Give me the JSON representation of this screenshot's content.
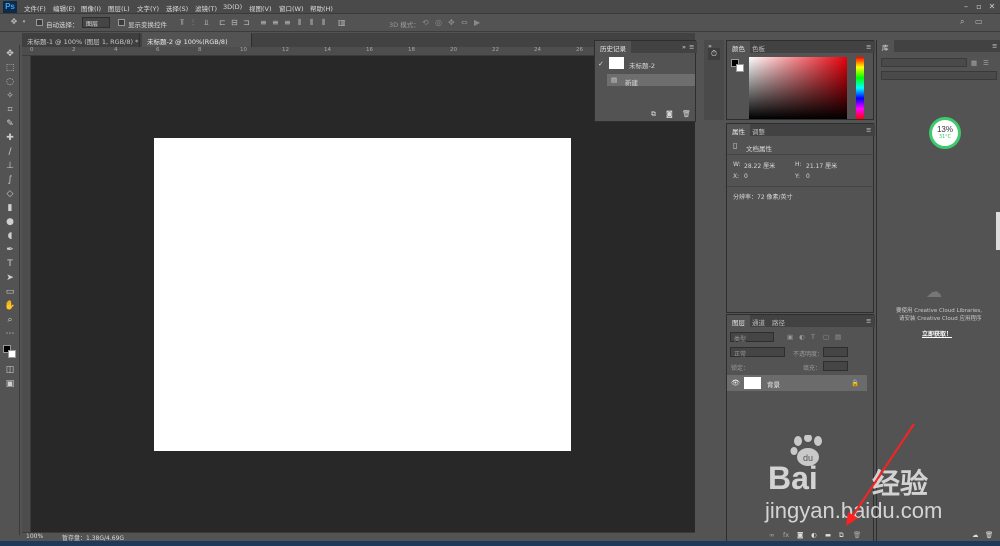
{
  "app": {
    "logo": "Ps"
  },
  "menu": [
    "文件(F)",
    "编辑(E)",
    "图像(I)",
    "图层(L)",
    "文字(Y)",
    "选择(S)",
    "滤镜(T)",
    "3D(D)",
    "视图(V)",
    "窗口(W)",
    "帮助(H)"
  ],
  "options": {
    "auto_select": "自动选择：",
    "auto_select_value": "图层",
    "show_transform": "显示变换控件",
    "mode_3d": "3D 模式："
  },
  "tabs": [
    {
      "label": "未标题-1 @ 100% (图层 1, RGB/8) *",
      "active": false
    },
    {
      "label": "未标题-2 @ 100%(RGB/8)",
      "active": true
    }
  ],
  "ruler": [
    "0",
    "2",
    "4",
    "6",
    "8",
    "10",
    "12",
    "14",
    "16",
    "18",
    "20",
    "22",
    "24",
    "26",
    "28",
    "30"
  ],
  "status": {
    "zoom": "100%",
    "scratch": "暂存盘：1.38G/4.69G"
  },
  "history": {
    "tab": "历史记录",
    "snapshot": "未标题-2",
    "step": "新建"
  },
  "color": {
    "tab1": "颜色",
    "tab2": "色板",
    "foreground": "#000000",
    "background": "#ffffff"
  },
  "properties": {
    "tab1": "属性",
    "tab2": "调整",
    "type": "文档属性",
    "w_label": "W:",
    "w_value": "28.22 厘米",
    "h_label": "H:",
    "h_value": "21.17 厘米",
    "x_label": "X:",
    "x_value": "0",
    "y_label": "Y:",
    "y_value": "0",
    "resolution": "分辨率：72 像素/英寸"
  },
  "layers": {
    "tab1": "图层",
    "tab2": "通道",
    "tab3": "路径",
    "filter": "类型",
    "blend": "正常",
    "opacity_label": "不透明度：",
    "lock_label": "锁定：",
    "fill_label": "填充：",
    "layer_name": "背景"
  },
  "library": {
    "tab": "库",
    "badge": "13%",
    "temp": "31°C",
    "msg1": "要使用 Creative Cloud Libraries,",
    "msg2": "请安装 Creative Cloud 应用程序",
    "link": "立即获取！"
  },
  "watermark": {
    "logo": "Bai",
    "logo2": "经验",
    "url": "jingyan.baidu.com"
  }
}
